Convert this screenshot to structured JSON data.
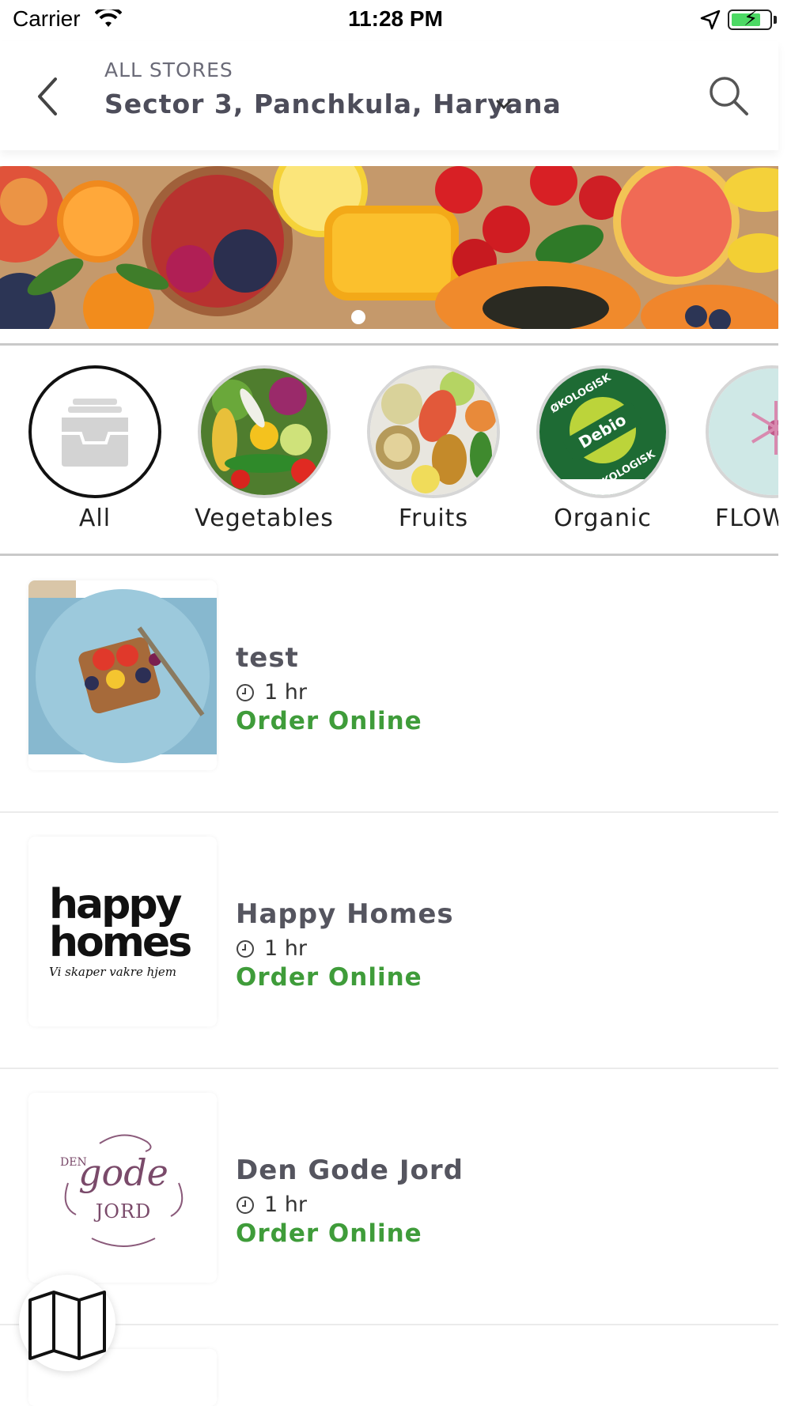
{
  "status_bar": {
    "carrier": "Carrier",
    "time": "11:28 PM"
  },
  "header": {
    "subtitle": "ALL STORES",
    "location": "Sector 3, Panchkula, Haryana"
  },
  "banner": {
    "page_count": 1,
    "active_page": 1
  },
  "categories": [
    {
      "label": "All",
      "icon": "inbox-tray-icon",
      "selected": true
    },
    {
      "label": "Vegetables",
      "icon": "vegetables-photo",
      "selected": false
    },
    {
      "label": "Fruits",
      "icon": "fruits-photo",
      "selected": false
    },
    {
      "label": "Organic",
      "icon": "debio-organic-logo",
      "selected": false
    },
    {
      "label": "FLOW",
      "icon": "flower-photo",
      "selected": false
    }
  ],
  "stores": [
    {
      "name": "test",
      "time": "1 hr",
      "cta": "Order Online",
      "thumb": "food-plate-photo"
    },
    {
      "name": "Happy Homes",
      "time": "1 hr",
      "cta": "Order Online",
      "thumb": "happy-homes-logo",
      "logo_text_1": "happy",
      "logo_text_2": "homes",
      "logo_tagline": "Vi skaper vakre hjem"
    },
    {
      "name": "Den Gode Jord",
      "time": "1 hr",
      "cta": "Order Online",
      "thumb": "den-gode-jord-logo",
      "logo_text_1": "DEN",
      "logo_text_2": "gode",
      "logo_text_3": "JORD"
    }
  ],
  "colors": {
    "accent_green": "#3f9c3a",
    "header_text": "#4d4d5a",
    "divider": "#c9c9c9"
  },
  "organic_logo": {
    "top": "ØKOLOGISK",
    "center": "Debio",
    "bottom": "ØKOLOGISK"
  }
}
